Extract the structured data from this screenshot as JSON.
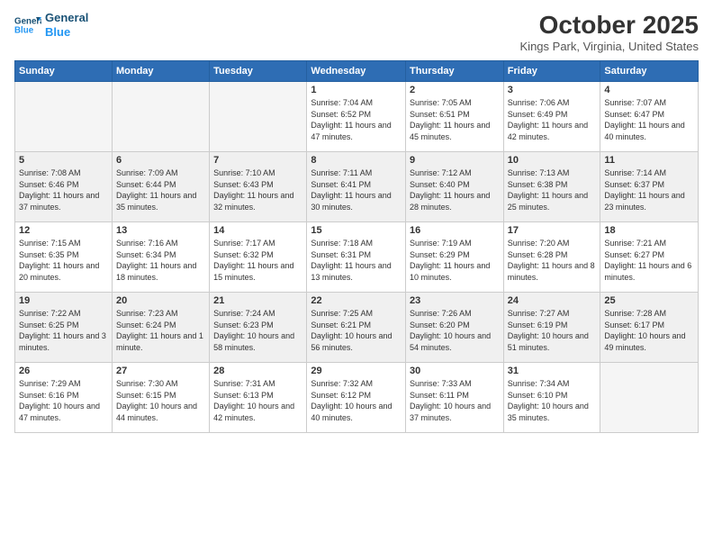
{
  "header": {
    "logo_line1": "General",
    "logo_line2": "Blue",
    "month": "October 2025",
    "location": "Kings Park, Virginia, United States"
  },
  "weekdays": [
    "Sunday",
    "Monday",
    "Tuesday",
    "Wednesday",
    "Thursday",
    "Friday",
    "Saturday"
  ],
  "weeks": [
    [
      {
        "num": "",
        "sunrise": "",
        "sunset": "",
        "daylight": "",
        "empty": true
      },
      {
        "num": "",
        "sunrise": "",
        "sunset": "",
        "daylight": "",
        "empty": true
      },
      {
        "num": "",
        "sunrise": "",
        "sunset": "",
        "daylight": "",
        "empty": true
      },
      {
        "num": "1",
        "sunrise": "Sunrise: 7:04 AM",
        "sunset": "Sunset: 6:52 PM",
        "daylight": "Daylight: 11 hours and 47 minutes."
      },
      {
        "num": "2",
        "sunrise": "Sunrise: 7:05 AM",
        "sunset": "Sunset: 6:51 PM",
        "daylight": "Daylight: 11 hours and 45 minutes."
      },
      {
        "num": "3",
        "sunrise": "Sunrise: 7:06 AM",
        "sunset": "Sunset: 6:49 PM",
        "daylight": "Daylight: 11 hours and 42 minutes."
      },
      {
        "num": "4",
        "sunrise": "Sunrise: 7:07 AM",
        "sunset": "Sunset: 6:47 PM",
        "daylight": "Daylight: 11 hours and 40 minutes."
      }
    ],
    [
      {
        "num": "5",
        "sunrise": "Sunrise: 7:08 AM",
        "sunset": "Sunset: 6:46 PM",
        "daylight": "Daylight: 11 hours and 37 minutes."
      },
      {
        "num": "6",
        "sunrise": "Sunrise: 7:09 AM",
        "sunset": "Sunset: 6:44 PM",
        "daylight": "Daylight: 11 hours and 35 minutes."
      },
      {
        "num": "7",
        "sunrise": "Sunrise: 7:10 AM",
        "sunset": "Sunset: 6:43 PM",
        "daylight": "Daylight: 11 hours and 32 minutes."
      },
      {
        "num": "8",
        "sunrise": "Sunrise: 7:11 AM",
        "sunset": "Sunset: 6:41 PM",
        "daylight": "Daylight: 11 hours and 30 minutes."
      },
      {
        "num": "9",
        "sunrise": "Sunrise: 7:12 AM",
        "sunset": "Sunset: 6:40 PM",
        "daylight": "Daylight: 11 hours and 28 minutes."
      },
      {
        "num": "10",
        "sunrise": "Sunrise: 7:13 AM",
        "sunset": "Sunset: 6:38 PM",
        "daylight": "Daylight: 11 hours and 25 minutes."
      },
      {
        "num": "11",
        "sunrise": "Sunrise: 7:14 AM",
        "sunset": "Sunset: 6:37 PM",
        "daylight": "Daylight: 11 hours and 23 minutes."
      }
    ],
    [
      {
        "num": "12",
        "sunrise": "Sunrise: 7:15 AM",
        "sunset": "Sunset: 6:35 PM",
        "daylight": "Daylight: 11 hours and 20 minutes."
      },
      {
        "num": "13",
        "sunrise": "Sunrise: 7:16 AM",
        "sunset": "Sunset: 6:34 PM",
        "daylight": "Daylight: 11 hours and 18 minutes."
      },
      {
        "num": "14",
        "sunrise": "Sunrise: 7:17 AM",
        "sunset": "Sunset: 6:32 PM",
        "daylight": "Daylight: 11 hours and 15 minutes."
      },
      {
        "num": "15",
        "sunrise": "Sunrise: 7:18 AM",
        "sunset": "Sunset: 6:31 PM",
        "daylight": "Daylight: 11 hours and 13 minutes."
      },
      {
        "num": "16",
        "sunrise": "Sunrise: 7:19 AM",
        "sunset": "Sunset: 6:29 PM",
        "daylight": "Daylight: 11 hours and 10 minutes."
      },
      {
        "num": "17",
        "sunrise": "Sunrise: 7:20 AM",
        "sunset": "Sunset: 6:28 PM",
        "daylight": "Daylight: 11 hours and 8 minutes."
      },
      {
        "num": "18",
        "sunrise": "Sunrise: 7:21 AM",
        "sunset": "Sunset: 6:27 PM",
        "daylight": "Daylight: 11 hours and 6 minutes."
      }
    ],
    [
      {
        "num": "19",
        "sunrise": "Sunrise: 7:22 AM",
        "sunset": "Sunset: 6:25 PM",
        "daylight": "Daylight: 11 hours and 3 minutes."
      },
      {
        "num": "20",
        "sunrise": "Sunrise: 7:23 AM",
        "sunset": "Sunset: 6:24 PM",
        "daylight": "Daylight: 11 hours and 1 minute."
      },
      {
        "num": "21",
        "sunrise": "Sunrise: 7:24 AM",
        "sunset": "Sunset: 6:23 PM",
        "daylight": "Daylight: 10 hours and 58 minutes."
      },
      {
        "num": "22",
        "sunrise": "Sunrise: 7:25 AM",
        "sunset": "Sunset: 6:21 PM",
        "daylight": "Daylight: 10 hours and 56 minutes."
      },
      {
        "num": "23",
        "sunrise": "Sunrise: 7:26 AM",
        "sunset": "Sunset: 6:20 PM",
        "daylight": "Daylight: 10 hours and 54 minutes."
      },
      {
        "num": "24",
        "sunrise": "Sunrise: 7:27 AM",
        "sunset": "Sunset: 6:19 PM",
        "daylight": "Daylight: 10 hours and 51 minutes."
      },
      {
        "num": "25",
        "sunrise": "Sunrise: 7:28 AM",
        "sunset": "Sunset: 6:17 PM",
        "daylight": "Daylight: 10 hours and 49 minutes."
      }
    ],
    [
      {
        "num": "26",
        "sunrise": "Sunrise: 7:29 AM",
        "sunset": "Sunset: 6:16 PM",
        "daylight": "Daylight: 10 hours and 47 minutes."
      },
      {
        "num": "27",
        "sunrise": "Sunrise: 7:30 AM",
        "sunset": "Sunset: 6:15 PM",
        "daylight": "Daylight: 10 hours and 44 minutes."
      },
      {
        "num": "28",
        "sunrise": "Sunrise: 7:31 AM",
        "sunset": "Sunset: 6:13 PM",
        "daylight": "Daylight: 10 hours and 42 minutes."
      },
      {
        "num": "29",
        "sunrise": "Sunrise: 7:32 AM",
        "sunset": "Sunset: 6:12 PM",
        "daylight": "Daylight: 10 hours and 40 minutes."
      },
      {
        "num": "30",
        "sunrise": "Sunrise: 7:33 AM",
        "sunset": "Sunset: 6:11 PM",
        "daylight": "Daylight: 10 hours and 37 minutes."
      },
      {
        "num": "31",
        "sunrise": "Sunrise: 7:34 AM",
        "sunset": "Sunset: 6:10 PM",
        "daylight": "Daylight: 10 hours and 35 minutes."
      },
      {
        "num": "",
        "sunrise": "",
        "sunset": "",
        "daylight": "",
        "empty": true
      }
    ]
  ]
}
